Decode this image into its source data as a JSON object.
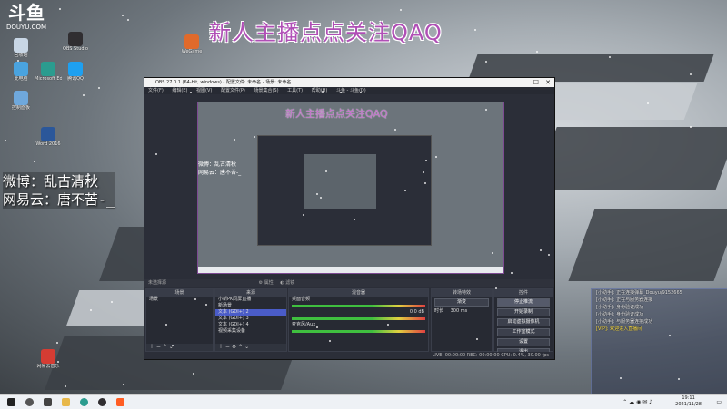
{
  "desktop": {
    "logo": {
      "mark": "斗鱼",
      "sub": "DOUYU.COM"
    },
    "banner": "新人主播点点关注QAQ",
    "overlay_lines": [
      "微博：乱古清秋",
      "网易云：唐不苦-_"
    ],
    "icons": [
      {
        "label": "回收站",
        "color": "#c8d6e5"
      },
      {
        "label": "此电脑",
        "color": "#4aa3df"
      },
      {
        "label": "Microsoft Edge",
        "color": "#2b9c8f"
      },
      {
        "label": "腾讯QQ",
        "color": "#1ea0f0"
      },
      {
        "label": "控制面板",
        "color": "#6fa8dc"
      },
      {
        "label": "Word 2016",
        "color": "#2b579a"
      },
      {
        "label": "OBS Studio",
        "color": "#302e31"
      },
      {
        "label": "WeGame",
        "color": "#e06a2b"
      },
      {
        "label": "网易云音乐",
        "color": "#d43c33"
      }
    ]
  },
  "obs": {
    "title": "OBS 27.0.1 (64-bit, windows) - 配置文件: 未命名 - 场景: 未命名",
    "menu": [
      "文件(F)",
      "编辑(E)",
      "视图(V)",
      "配置文件(P)",
      "场景集合(S)",
      "工具(T)",
      "帮助(H)",
      "斗鱼 - 斗鱼(D)"
    ],
    "preview_banner": "新人主播点点关注QAQ",
    "preview_weibo": [
      "微博：乱古清秋",
      "网易云：唐不苦-_"
    ],
    "no_source": "未选择源",
    "props_label": "属性",
    "filters_label": "滤镜",
    "docks": {
      "scenes": {
        "title": "场景",
        "items": [
          "场景"
        ]
      },
      "sources": {
        "title": "来源",
        "items": [
          "小新PK同屏直播",
          "新场景",
          "文本 (GDI+) 2",
          "文本 (GDI+) 3",
          "文本 (GDI+) 4",
          "视频采集设备"
        ],
        "selected": 2
      },
      "mixer": {
        "title": "混音器",
        "channels": [
          {
            "name": "桌面音频",
            "db": "0.0 dB"
          },
          {
            "name": "麦克风/Aux",
            "db": "0.0 dB"
          }
        ]
      },
      "transitions": {
        "title": "转场特效",
        "type": "渐变",
        "duration_label": "时长",
        "duration": "300 ms"
      },
      "controls": {
        "title": "控件",
        "buttons": [
          "停止推流",
          "开始录制",
          "启动虚拟摄像机",
          "工作室模式",
          "设置",
          "退出"
        ]
      }
    },
    "status": "LIVE: 00:00:00  REC: 00:00:00  CPU: 0.4%, 30.00 fps"
  },
  "chat": {
    "lines": [
      "[小助手]: 正在连接弹幕_Douyu/9152665",
      "[小助手]: 正在与服务器连接",
      "[小助手]: 身份验证成功",
      "[小助手]: 身份验证成功",
      "[小助手]: 与服务器连接成功",
      "[VIP]: 欢迎进入直播间"
    ],
    "highlight_index": 5
  },
  "taskbar": {
    "time": "19:11",
    "date": "2021/11/28",
    "apps": [
      "start",
      "search",
      "taskview",
      "explorer",
      "edge",
      "obs",
      "douyu",
      "chrome",
      "qq"
    ]
  }
}
